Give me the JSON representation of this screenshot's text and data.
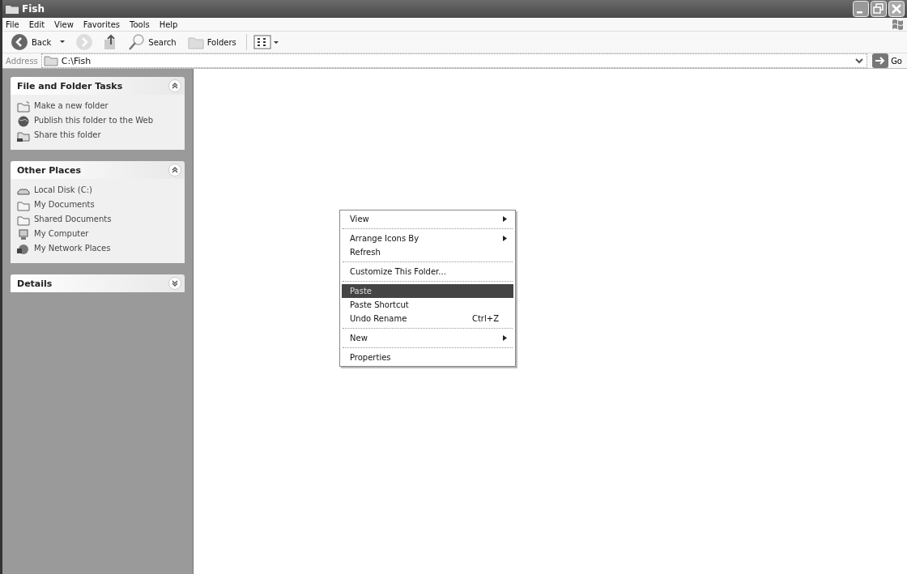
{
  "window": {
    "title": "Fish"
  },
  "menu_bar": [
    "File",
    "Edit",
    "View",
    "Favorites",
    "Tools",
    "Help"
  ],
  "toolbar": {
    "back": "Back",
    "search": "Search",
    "folders": "Folders"
  },
  "address": {
    "label": "Address",
    "value": "C:\\Fish",
    "go": "Go"
  },
  "task_panels": [
    {
      "title": "File and Folder Tasks",
      "expanded": true,
      "items": [
        {
          "kind": "new-folder",
          "label": "Make a new folder"
        },
        {
          "kind": "globe",
          "label": "Publish this folder to the Web"
        },
        {
          "kind": "share",
          "label": "Share this folder"
        }
      ]
    },
    {
      "title": "Other Places",
      "expanded": true,
      "items": [
        {
          "kind": "drive",
          "label": "Local Disk (C:)"
        },
        {
          "kind": "folder",
          "label": "My Documents"
        },
        {
          "kind": "folder",
          "label": "Shared Documents"
        },
        {
          "kind": "computer",
          "label": "My Computer"
        },
        {
          "kind": "network",
          "label": "My Network Places"
        }
      ]
    },
    {
      "title": "Details",
      "expanded": false
    }
  ],
  "context_menu": [
    {
      "kind": "item",
      "label": "View",
      "submenu": true,
      "selected": false
    },
    {
      "kind": "separator"
    },
    {
      "kind": "item",
      "label": "Arrange Icons By",
      "submenu": true,
      "selected": false
    },
    {
      "kind": "item",
      "label": "Refresh",
      "submenu": false,
      "selected": false
    },
    {
      "kind": "separator"
    },
    {
      "kind": "item",
      "label": "Customize This Folder...",
      "submenu": false,
      "selected": false
    },
    {
      "kind": "separator"
    },
    {
      "kind": "item",
      "label": "Paste",
      "submenu": false,
      "selected": true
    },
    {
      "kind": "item",
      "label": "Paste Shortcut",
      "submenu": false,
      "selected": false
    },
    {
      "kind": "item",
      "label": "Undo Rename",
      "shortcut": "Ctrl+Z",
      "submenu": false,
      "selected": false
    },
    {
      "kind": "separator"
    },
    {
      "kind": "item",
      "label": "New",
      "submenu": true,
      "selected": false
    },
    {
      "kind": "separator"
    },
    {
      "kind": "item",
      "label": "Properties",
      "submenu": false,
      "selected": false
    }
  ]
}
